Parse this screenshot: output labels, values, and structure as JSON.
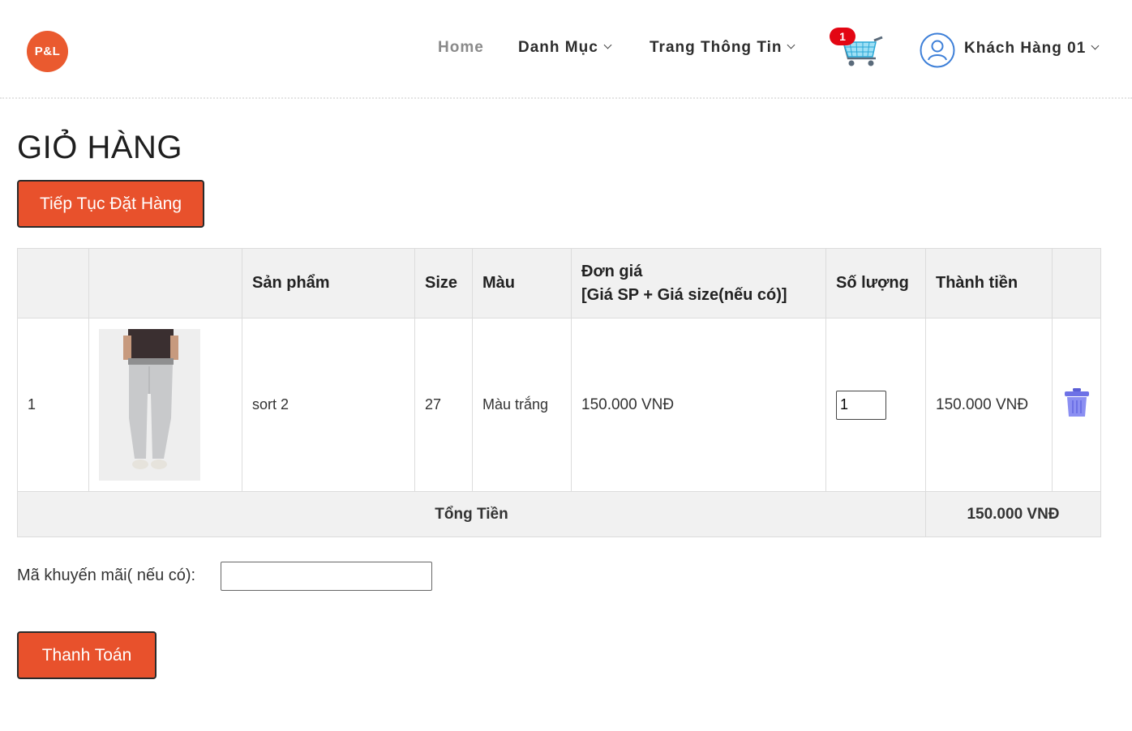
{
  "header": {
    "logo_text": "P&L",
    "nav": {
      "home": "Home",
      "categories": "Danh Mục",
      "info": "Trang Thông Tin"
    },
    "cart_count": "1",
    "user_name": "Khách Hàng 01"
  },
  "page": {
    "title": "GIỎ HÀNG",
    "continue_button": "Tiếp Tục Đặt Hàng",
    "pay_button": "Thanh Toán"
  },
  "table": {
    "columns": {
      "index": "",
      "image": "",
      "product": "Sản phẩm",
      "size": "Size",
      "color": "Màu",
      "unit_price_line1": "Đơn giá",
      "unit_price_line2": "[Giá SP + Giá size(nếu có)]",
      "quantity": "Số lượng",
      "subtotal": "Thành tiền",
      "action": ""
    },
    "rows": [
      {
        "index": "1",
        "product": "sort 2",
        "size": "27",
        "color": "Màu trắng",
        "unit_price": "150.000 VNĐ",
        "quantity": "1",
        "subtotal": "150.000 VNĐ"
      }
    ],
    "total_label": "Tổng Tiền",
    "total_value": "150.000 VNĐ"
  },
  "promo": {
    "label": "Mã khuyến mãi( nếu có):",
    "value": ""
  },
  "colors": {
    "accent": "#e8512c",
    "total_red": "#d9232d",
    "badge": "#e30613",
    "trash": "#7b7ff0"
  }
}
